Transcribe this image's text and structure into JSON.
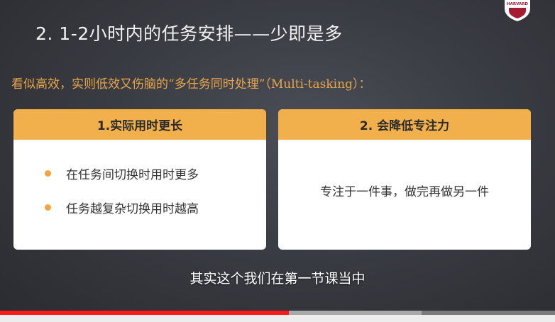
{
  "slide": {
    "title": "2. 1-2小时内的任务安排——少即是多",
    "subtitle": "看似高效，实则低效又伤脑的“多任务同时处理”（Multi-tasking）：",
    "logo_text": "HARVARD",
    "cards": [
      {
        "header": "1.实际用时更长",
        "bullets": [
          "在任务间切换时用时更多",
          "任务越复杂切换用时越高"
        ]
      },
      {
        "header": "2. 会降低专注力",
        "text": "专注于一件事，做完再做另一件"
      }
    ]
  },
  "subtitle_caption": "其实这个我们在第一节课当中",
  "player": {
    "played_fraction": 0.52,
    "buffered_fraction": 0.76
  },
  "colors": {
    "accent": "#f2b04c",
    "subtitle": "#e8a64a",
    "progress": "#ff1a1a"
  }
}
